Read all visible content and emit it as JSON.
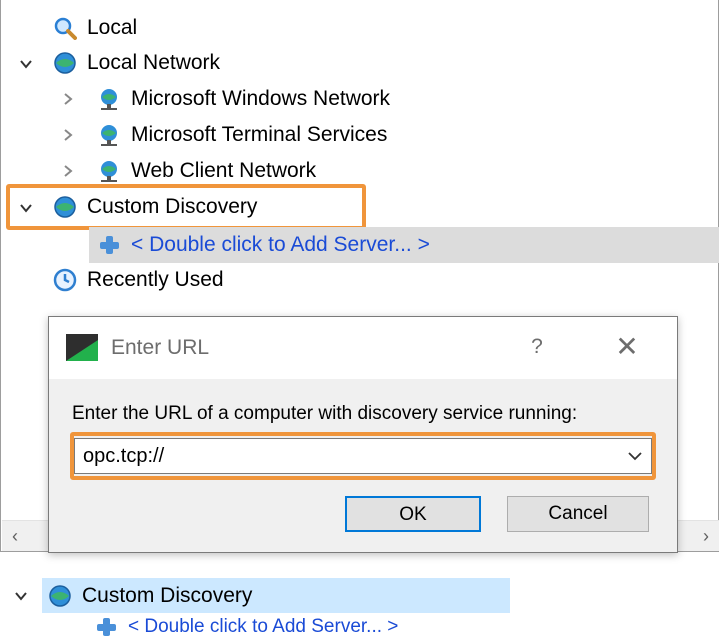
{
  "tree": {
    "items": [
      {
        "label": "Local",
        "icon": "magnifier-icon"
      },
      {
        "label": "Local Network",
        "icon": "globe-network-icon",
        "expanded": true
      },
      {
        "label": "Microsoft Windows Network",
        "icon": "network-globe-icon"
      },
      {
        "label": "Microsoft Terminal Services",
        "icon": "network-globe-icon"
      },
      {
        "label": "Web Client Network",
        "icon": "network-globe-icon"
      },
      {
        "label": "Custom Discovery",
        "icon": "globe-network-icon",
        "expanded": true
      },
      {
        "label": "< Double click to Add Server... >",
        "icon": "plus-icon"
      },
      {
        "label": "Recently Used",
        "icon": "clock-icon"
      }
    ]
  },
  "dialog": {
    "title": "Enter URL",
    "help": "?",
    "close": "✕",
    "prompt": "Enter the URL of a computer with discovery service running:",
    "url_value": "opc.tcp://",
    "ok_label": "OK",
    "cancel_label": "Cancel"
  },
  "detail": {
    "custom_discovery": "Custom Discovery",
    "add_server": "< Double click to Add Server... >"
  },
  "colors": {
    "highlight": "#f0953b",
    "link": "#1a4bd6",
    "selection": "#cce8ff"
  }
}
